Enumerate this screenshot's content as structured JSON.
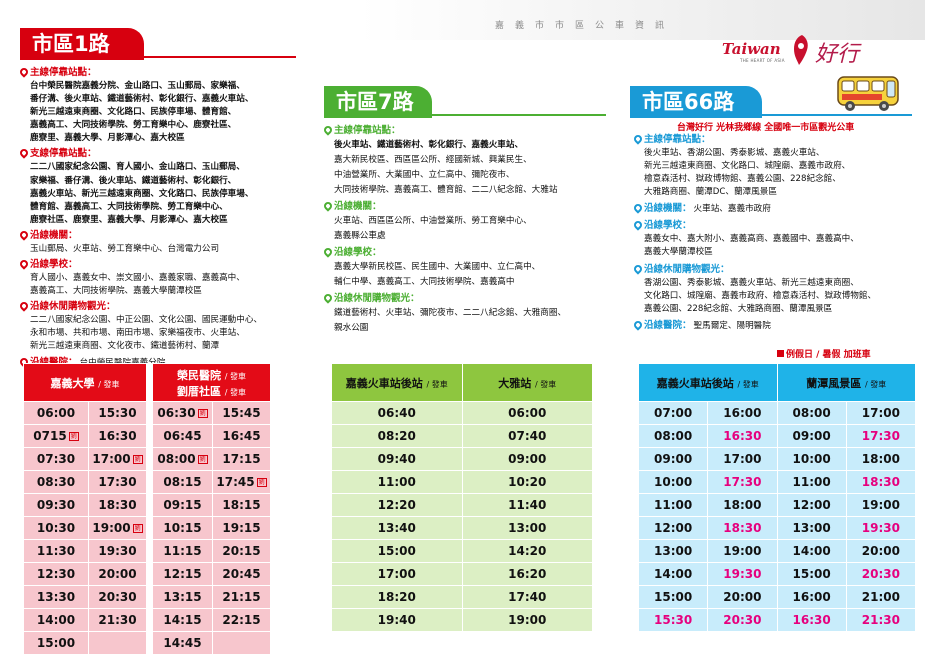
{
  "header": {
    "title": "嘉義市市區公車資訊"
  },
  "brand": {
    "word": "Taiwan",
    "sub": "THE HEART OF ASIA",
    "script": "好行"
  },
  "route1": {
    "title": "市區1路",
    "sections": [
      {
        "head": "主線停靠站點：",
        "lines": [
          "台中榮民醫院嘉義分院、金山路口、玉山郵局、家樂福、",
          "番仔溝、後火車站、鐵道藝術村、彰化銀行、嘉義火車站、",
          "新光三越遠東商圈、文化路口、民族停車場、體育館、",
          "嘉義高工、大同技術學院、勞工育樂中心、鹿寮社區、",
          "鹿寮里、嘉義大學、月影潭心、嘉大校區"
        ]
      },
      {
        "head": "支線停靠站點：",
        "lines": [
          "二二八國家紀念公園、育人國小、金山路口、玉山郵局、",
          "家樂福、番仔溝、後火車站、鐵道藝術村、彰化銀行、",
          "嘉義火車站、新光三越遠東商圈、文化路口、民族停車場、",
          "體育館、嘉義高工、大同技術學院、勞工育樂中心、",
          "鹿寮社區、鹿寮里、嘉義大學、月影潭心、嘉大校區"
        ]
      },
      {
        "head": "沿線機關：",
        "lines": [
          "玉山郵局、火車站、勞工育樂中心、台灣電力公司"
        ]
      },
      {
        "head": "沿線學校：",
        "lines": [
          "育人國小、嘉義女中、崇文國小、嘉義家職、嘉義高中、",
          "嘉義高工、大同技術學院、嘉義大學蘭潭校區"
        ]
      },
      {
        "head": "沿線休閒購物觀光：",
        "lines": [
          "二二八國家紀念公園、中正公園、文化公園、國民運動中心、",
          "永和市場、共和市場、南田市場、家樂福夜市、火車站、",
          "新光三越遠東商圈、文化夜市、鐵道藝術村、蘭潭"
        ]
      }
    ],
    "hospital_head": "沿線醫院：",
    "hospital_text": "台中榮民醫院嘉義分院",
    "table": {
      "h1": "嘉義大學",
      "h1_sub": "/ 發車",
      "h2a": "榮民醫院",
      "h2a_sub": "/ 發車",
      "h2b": "劉厝社區",
      "h2b_sub": "/ 發車",
      "mark": "劉",
      "rows": [
        [
          "06:00",
          "15:30",
          "06:30",
          "15:45"
        ],
        [
          "0715",
          "16:30",
          "06:45",
          "16:45"
        ],
        [
          "07:30",
          "17:00",
          "08:00",
          "17:15"
        ],
        [
          "08:30",
          "17:30",
          "08:15",
          "17:45"
        ],
        [
          "09:30",
          "18:30",
          "09:15",
          "18:15"
        ],
        [
          "10:30",
          "19:00",
          "10:15",
          "19:15"
        ],
        [
          "11:30",
          "19:30",
          "11:15",
          "20:15"
        ],
        [
          "12:30",
          "20:00",
          "12:15",
          "20:45"
        ],
        [
          "13:30",
          "20:30",
          "13:15",
          "21:15"
        ],
        [
          "14:00",
          "21:30",
          "14:15",
          "22:15"
        ],
        [
          "15:00",
          "",
          "14:45",
          ""
        ]
      ]
    }
  },
  "route7": {
    "title": "市區7路",
    "sections": [
      {
        "head": "主線停靠站點：",
        "lines": [
          "後火車站、鐵道藝術村、彰化銀行、嘉義火車站、",
          "嘉大新民校區、西區區公所、經國新城、興業民生、",
          "中油營業所、大業國中、立仁高中、彌陀夜市、",
          "大同技術學院、嘉義高工、體育館、二二八紀念館、大雅站"
        ]
      },
      {
        "head": "沿線機關：",
        "lines": [
          "火車站、西區區公所、中油營業所、勞工育樂中心、",
          "嘉義縣公車處"
        ]
      },
      {
        "head": "沿線學校：",
        "lines": [
          "嘉義大學新民校區、民生國中、大業國中、立仁高中、",
          "輔仁中學、嘉義高工、大同技術學院、嘉義高中"
        ]
      },
      {
        "head": "沿線休閒購物觀光：",
        "lines": [
          "鐵道藝術村、火車站、彌陀夜市、二二八紀念館、大雅商圈、",
          "親水公園"
        ]
      }
    ],
    "table": {
      "h1": "嘉義火車站後站",
      "h1_sub": "/ 發車",
      "h2": "大雅站",
      "h2_sub": "/ 發車",
      "rows": [
        [
          "06:40",
          "06:00"
        ],
        [
          "08:20",
          "07:40"
        ],
        [
          "09:40",
          "09:00"
        ],
        [
          "11:00",
          "10:20"
        ],
        [
          "12:20",
          "11:40"
        ],
        [
          "13:40",
          "13:00"
        ],
        [
          "15:00",
          "14:20"
        ],
        [
          "17:00",
          "16:20"
        ],
        [
          "18:20",
          "17:40"
        ],
        [
          "19:40",
          "19:00"
        ]
      ]
    }
  },
  "route66": {
    "title": "市區66路",
    "highlight": "台灣好行  光林我鄉線  全國唯一市區觀光公車",
    "sections": [
      {
        "head": "主線停靠站點：",
        "lines": [
          "後火車站、香湖公園、秀泰影城、嘉義火車站、",
          "新光三越遠東商圈、文化路口、城隍廟、嘉義市政府、",
          "檜意森活村、獄政博物館、嘉義公園、228紀念館、",
          "大雅路商圈、蘭潭DC、蘭潭風景區"
        ]
      },
      {
        "head": "沿線機關：",
        "inline": "火車站、嘉義市政府"
      },
      {
        "head": "沿線學校：",
        "lines": [
          "嘉義女中、嘉大附小、嘉義高商、嘉義國中、嘉義高中、",
          "嘉義大學蘭潭校區"
        ]
      },
      {
        "head": "沿線休閒購物觀光：",
        "lines": [
          "香湖公園、秀泰影城、嘉義火車站、新光三越遠東商圈、",
          "文化路口、城隍廟、嘉義市政府、檜意森活村、獄政博物館、",
          "嘉義公園、228紀念館、大雅路商圈、蘭潭風景區"
        ]
      },
      {
        "head": "沿線醫院：",
        "inline": "聖馬爾定、陽明醫院"
      }
    ],
    "notice": "例假日 / 暑假  加班車",
    "table": {
      "h1": "嘉義火車站後站",
      "h1_sub": "/ 發車",
      "h2": "蘭潭風景區",
      "h2_sub": "/ 發車",
      "rows": [
        [
          "07:00",
          "16:00",
          "08:00",
          "17:00"
        ],
        [
          "08:00",
          "16:30",
          "09:00",
          "17:30"
        ],
        [
          "09:00",
          "17:00",
          "10:00",
          "18:00"
        ],
        [
          "10:00",
          "17:30",
          "11:00",
          "18:30"
        ],
        [
          "11:00",
          "18:00",
          "12:00",
          "19:00"
        ],
        [
          "12:00",
          "18:30",
          "13:00",
          "19:30"
        ],
        [
          "13:00",
          "19:00",
          "14:00",
          "20:00"
        ],
        [
          "14:00",
          "19:30",
          "15:00",
          "20:30"
        ],
        [
          "15:00",
          "20:00",
          "16:00",
          "21:00"
        ],
        [
          "15:30",
          "20:30",
          "16:30",
          "21:30"
        ]
      ],
      "highlight_color": "#e6007e"
    }
  }
}
